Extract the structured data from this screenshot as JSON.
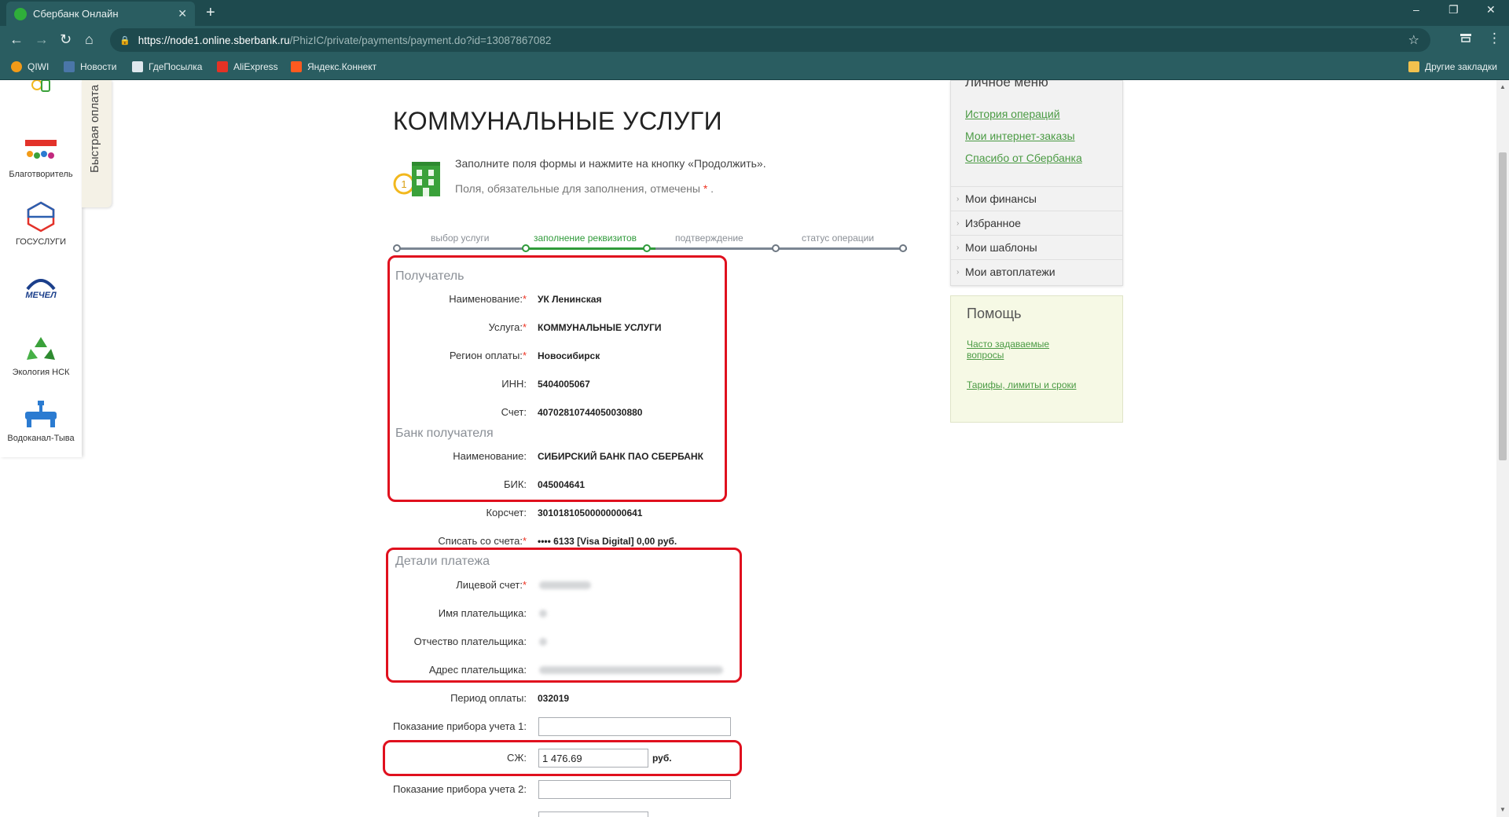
{
  "browser": {
    "tab_title": "Сбербанк Онлайн",
    "tab_close": "✕",
    "new_tab": "+",
    "url_host": "https://node1.online.sberbank.ru",
    "url_path": "/PhizIC/private/payments/payment.do?id=13087867082",
    "bookmarks": [
      "QIWI",
      "Новости",
      "ГдеПосылка",
      "AliExpress",
      "Яндекс.Коннект"
    ],
    "other_bookmarks": "Другие закладки",
    "controls": {
      "minimize": "–",
      "maximize": "❐",
      "close": "✕",
      "back": "←",
      "forward": "→",
      "reload": "↻",
      "home": "⌂",
      "star": "☆",
      "menu": "⋮"
    }
  },
  "left_panel": {
    "items": [
      "Благотворитель",
      "ГОСУСЛУГИ",
      "Экология НСК",
      "Водоканал-Тыва"
    ],
    "quick_pay": "Быстрая оплата"
  },
  "page": {
    "title": "КОММУНАЛЬНЫЕ УСЛУГИ",
    "intro": "Заполните поля формы и нажмите на кнопку «Продолжить».",
    "required_note": "Поля, обязательные для заполнения, отмечены",
    "required_mark": "*",
    "steps": [
      "выбор услуги",
      "заполнение реквизитов",
      "подтверждение",
      "статус операции"
    ]
  },
  "form": {
    "recipient_section": "Получатель",
    "name_label": "Наименование:",
    "name_value": "УК Ленинская",
    "service_label": "Услуга:",
    "service_value": "КОММУНАЛЬНЫЕ УСЛУГИ",
    "region_label": "Регион оплаты:",
    "region_value": "Новосибирск",
    "inn_label": "ИНН:",
    "inn_value": "5404005067",
    "account_label": "Счет:",
    "account_value": "40702810744050030880",
    "bank_section": "Банк получателя",
    "bank_name_label": "Наименование:",
    "bank_name_value": "СИБИРСКИЙ БАНК ПАО СБЕРБАНК",
    "bik_label": "БИК:",
    "bik_value": "045004641",
    "corr_label": "Корсчет:",
    "corr_value": "30101810500000000641",
    "debit_label": "Списать со счета:",
    "debit_value": "•••• 6133  [Visa Digital] 0,00    руб.",
    "details_section": "Детали платежа",
    "personal_account_label": "Лицевой счет:",
    "payer_name_label": "Имя плательщика:",
    "payer_patronymic_label": "Отчество плательщика:",
    "payer_address_label": "Адрес плательщика:",
    "period_label": "Период оплаты:",
    "period_value": "032019",
    "meter1_label": "Показание прибора учета 1:",
    "meter1_value": "",
    "sj_label": "СЖ:",
    "sj_value": "1 476.69",
    "sj_currency": "руб.",
    "meter2_label": "Показание прибора учета 2:",
    "meter2_value": ""
  },
  "right_menu": {
    "title": "Личное меню",
    "links": [
      "История операций",
      "Мои интернет-заказы",
      "Спасибо от Сбербанка"
    ],
    "items": [
      "Мои финансы",
      "Избранное",
      "Мои шаблоны",
      "Мои автоплатежи"
    ]
  },
  "help": {
    "title": "Помощь",
    "links": [
      "Часто задаваемые вопросы",
      "Тарифы, лимиты и сроки"
    ]
  },
  "colors": {
    "browser_dark": "#1e4a4e",
    "browser_mid": "#2a5d61",
    "accent_green": "#2f9a3a",
    "link_green": "#4a9a43",
    "highlight_red": "#e0101e"
  }
}
